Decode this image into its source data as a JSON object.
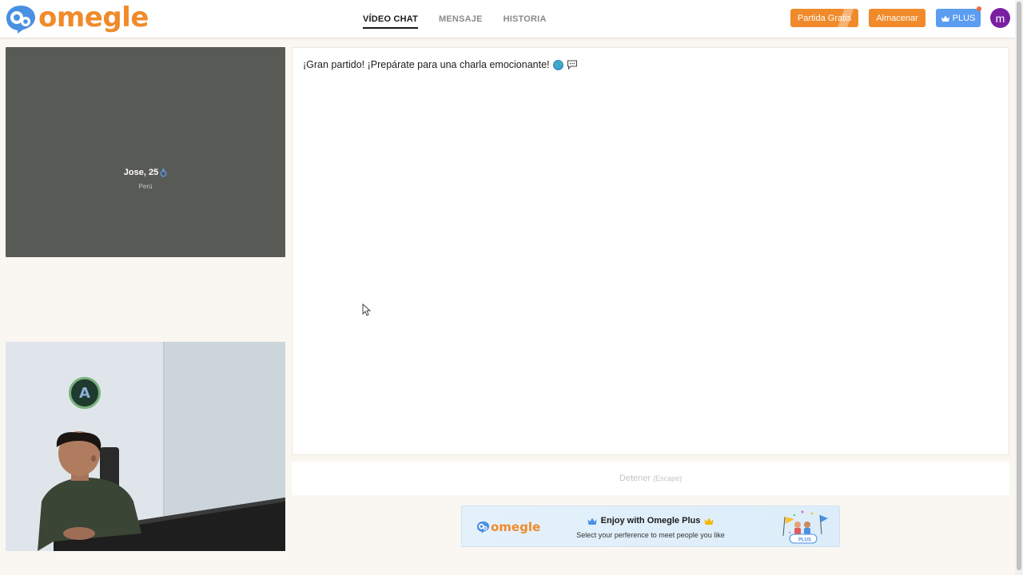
{
  "brand": {
    "name": "omegle"
  },
  "nav": {
    "tabs": [
      {
        "label": "VÍDEO CHAT",
        "active": true
      },
      {
        "label": "MENSAJE",
        "active": false
      },
      {
        "label": "HISTORIA",
        "active": false
      }
    ]
  },
  "header_buttons": {
    "partida": "Partida Gratis",
    "almacenar": "Almacenar",
    "plus": "PLUS",
    "avatar_initial": "m"
  },
  "remote": {
    "name": "Jose, 25",
    "gender_icon": "male-icon",
    "country": "Perú"
  },
  "local": {
    "badge_letter": "A"
  },
  "chat": {
    "message": "¡Gran partido! ¡Prepárate para una charla emocionante!"
  },
  "stop": {
    "label": "Detener",
    "hint": "(Escape)"
  },
  "banner": {
    "logo": "omegle",
    "title": "Enjoy with Omegle Plus",
    "subtitle": "Select your perference to meet people you like",
    "art_badge": "PLUS"
  },
  "colors": {
    "brand_orange": "#f08a2a",
    "brand_blue": "#4a90e2",
    "plus_blue": "#5b9df0",
    "avatar_purple": "#7a1fa2",
    "page_bg": "#faf6f1"
  }
}
